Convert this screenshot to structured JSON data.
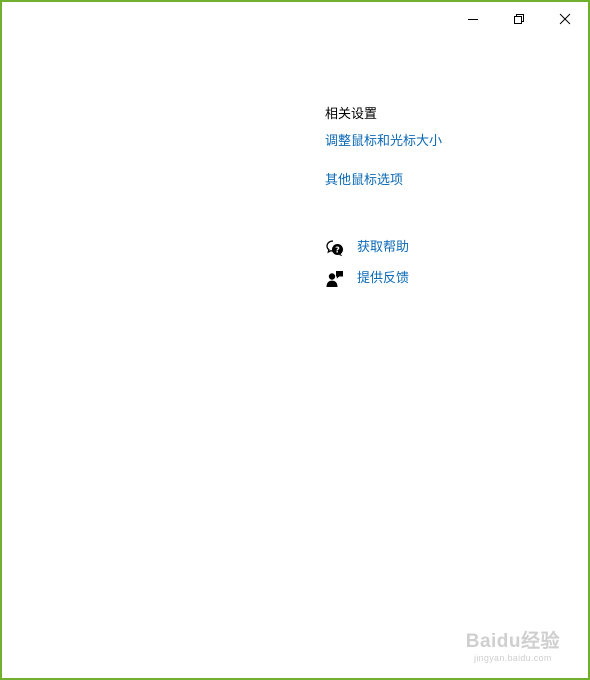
{
  "window": {
    "controls": {
      "minimize_icon": "minimize-icon",
      "restore_icon": "restore-icon",
      "close_icon": "close-icon"
    },
    "border_color": "#6fb12e"
  },
  "related_settings": {
    "title": "相关设置",
    "links": [
      {
        "label": "调整鼠标和光标大小"
      },
      {
        "label": "其他鼠标选项"
      }
    ]
  },
  "help": {
    "items": [
      {
        "icon": "get-help-icon",
        "label": "获取帮助"
      },
      {
        "icon": "feedback-icon",
        "label": "提供反馈"
      }
    ]
  },
  "colors": {
    "link": "#0a69b6",
    "text": "#000000"
  },
  "watermark": {
    "logo": "Baidu经验",
    "url": "jingyan.baidu.com"
  }
}
